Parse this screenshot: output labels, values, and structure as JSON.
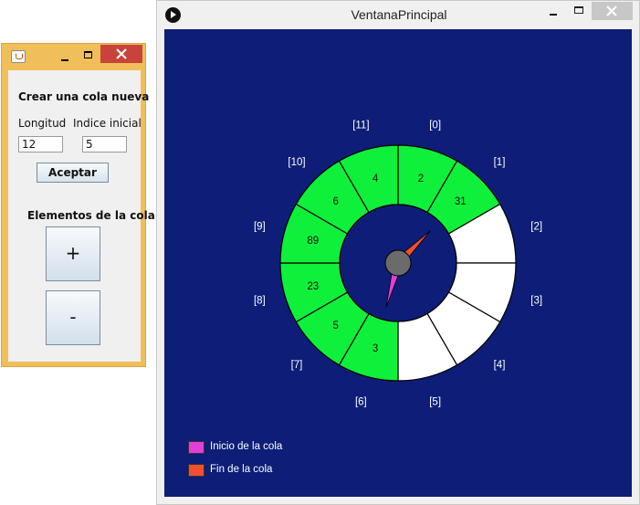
{
  "small_window": {
    "section_create": "Crear una cola nueva",
    "length_label": "Longitud",
    "start_index_label": "Indice inicial",
    "length_value": "12",
    "start_index_value": "5",
    "accept_button": "Aceptar",
    "section_elements": "Elementos de la cola",
    "add_button": "+",
    "remove_button": "-"
  },
  "main_window": {
    "title": "VentanaPrincipal",
    "queue": {
      "length": 12,
      "slots": [
        {
          "index_label": "[0]",
          "value": "2",
          "occupied": true
        },
        {
          "index_label": "[1]",
          "value": "31",
          "occupied": true
        },
        {
          "index_label": "[2]",
          "value": "",
          "occupied": false
        },
        {
          "index_label": "[3]",
          "value": "",
          "occupied": false
        },
        {
          "index_label": "[4]",
          "value": "",
          "occupied": false
        },
        {
          "index_label": "[5]",
          "value": "",
          "occupied": false
        },
        {
          "index_label": "[6]",
          "value": "3",
          "occupied": true
        },
        {
          "index_label": "[7]",
          "value": "5",
          "occupied": true
        },
        {
          "index_label": "[8]",
          "value": "23",
          "occupied": true
        },
        {
          "index_label": "[9]",
          "value": "89",
          "occupied": true
        },
        {
          "index_label": "[10]",
          "value": "6",
          "occupied": true
        },
        {
          "index_label": "[11]",
          "value": "4",
          "occupied": true
        }
      ],
      "head_index": 6,
      "tail_index": 1
    },
    "legend": [
      {
        "label": "Inicio de la cola",
        "color": "#e33fd6"
      },
      {
        "label": "Fin de la cola",
        "color": "#f0502e"
      }
    ]
  },
  "colors": {
    "canvas_bg": "#0d1d78",
    "occupied": "#0ef03a",
    "empty": "#ffffff",
    "head_needle": "#e33fd6",
    "tail_needle": "#f0502e",
    "hub": "#6b6b6b"
  }
}
